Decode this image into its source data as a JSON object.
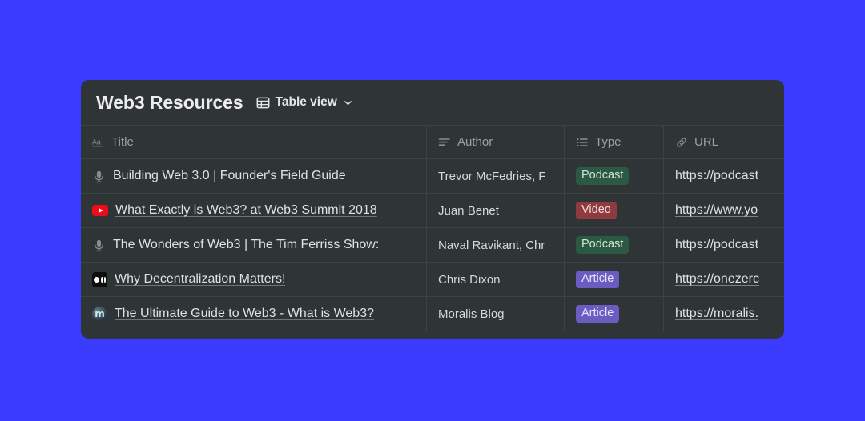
{
  "page": {
    "background_color": "#3b3bfe"
  },
  "card": {
    "background_color": "#2f3437",
    "title": "Web3 Resources",
    "view_switch": {
      "icon": "table-grid-icon",
      "label": "Table view",
      "chevron": "chevron-down-icon"
    }
  },
  "table": {
    "columns": [
      {
        "icon": "aa-text-icon",
        "label": "Title"
      },
      {
        "icon": "text-lines-icon",
        "label": "Author"
      },
      {
        "icon": "bulleted-list-icon",
        "label": "Type"
      },
      {
        "icon": "link-icon",
        "label": "URL"
      }
    ],
    "rows": [
      {
        "icon": "microphone-icon",
        "title": "Building Web 3.0 | Founder's Field Guide",
        "author": "Trevor McFedries, F",
        "type": "Podcast",
        "type_color": "#2b5943",
        "url": "https://podcast"
      },
      {
        "icon": "youtube-icon",
        "title": "What Exactly is Web3? at Web3 Summit 2018",
        "author": "Juan Benet",
        "type": "Video",
        "type_color": "#8e3b40",
        "url": "https://www.yo"
      },
      {
        "icon": "microphone-icon",
        "title": "The Wonders of Web3 | The Tim Ferriss Show:",
        "author": "Naval Ravikant, Chr",
        "type": "Podcast",
        "type_color": "#2b5943",
        "url": "https://podcast"
      },
      {
        "icon": "medium-icon",
        "title": "Why Decentralization Matters!",
        "author": "Chris Dixon",
        "type": "Article",
        "type_color": "#6b5cc2",
        "url": "https://onezerc"
      },
      {
        "icon": "moralis-icon",
        "title": "The Ultimate Guide to Web3 - What is Web3?",
        "author": "Moralis Blog",
        "type": "Article",
        "type_color": "#6b5cc2",
        "url": "https://moralis."
      }
    ]
  }
}
